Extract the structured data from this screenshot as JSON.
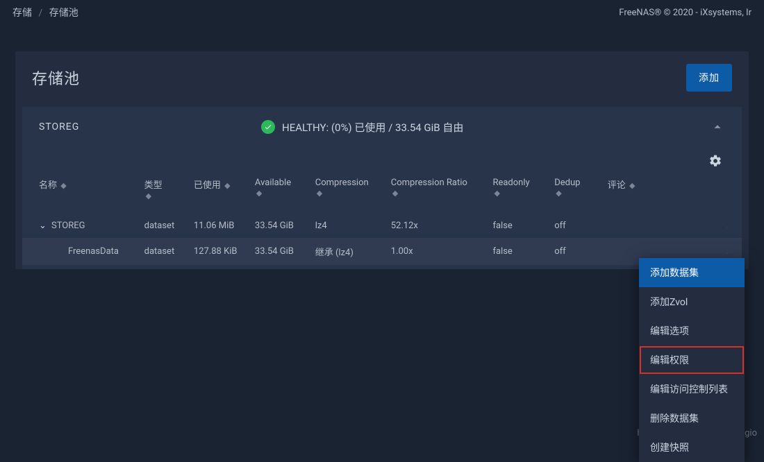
{
  "breadcrumb": {
    "root": "存储",
    "current": "存储池"
  },
  "brand": "FreeNAS® © 2020 - iXsystems, Ir",
  "panel": {
    "title": "存储池",
    "add_label": "添加"
  },
  "pool": {
    "name": "STOREG",
    "status": "HEALTHY: (0%) 已使用 / 33.54 GiB 自由"
  },
  "columns": {
    "name": "名称",
    "type": "类型",
    "used": "已使用",
    "available": "Available",
    "compression": "Compression",
    "ratio": "Compression Ratio",
    "readonly": "Readonly",
    "dedup": "Dedup",
    "comments": "评论"
  },
  "rows": [
    {
      "name": "STOREG",
      "type": "dataset",
      "used": "11.06 MiB",
      "available": "33.54 GiB",
      "compression": "lz4",
      "ratio": "52.12x",
      "readonly": "false",
      "dedup": "off",
      "comments": ""
    },
    {
      "name": "FreenasData",
      "type": "dataset",
      "used": "127.88 KiB",
      "available": "33.54 GiB",
      "compression": "继承 (lz4)",
      "ratio": "1.00x",
      "readonly": "false",
      "dedup": "off",
      "comments": ""
    }
  ],
  "menu": {
    "add_dataset": "添加数据集",
    "add_zvol": "添加Zvol",
    "edit_options": "编辑选项",
    "edit_permissions": "编辑权限",
    "edit_acl": "编辑访问控制列表",
    "delete_dataset": "删除数据集",
    "create_snapshot": "创建快照"
  },
  "watermark": "https://blog.csdn.net/tladagio"
}
